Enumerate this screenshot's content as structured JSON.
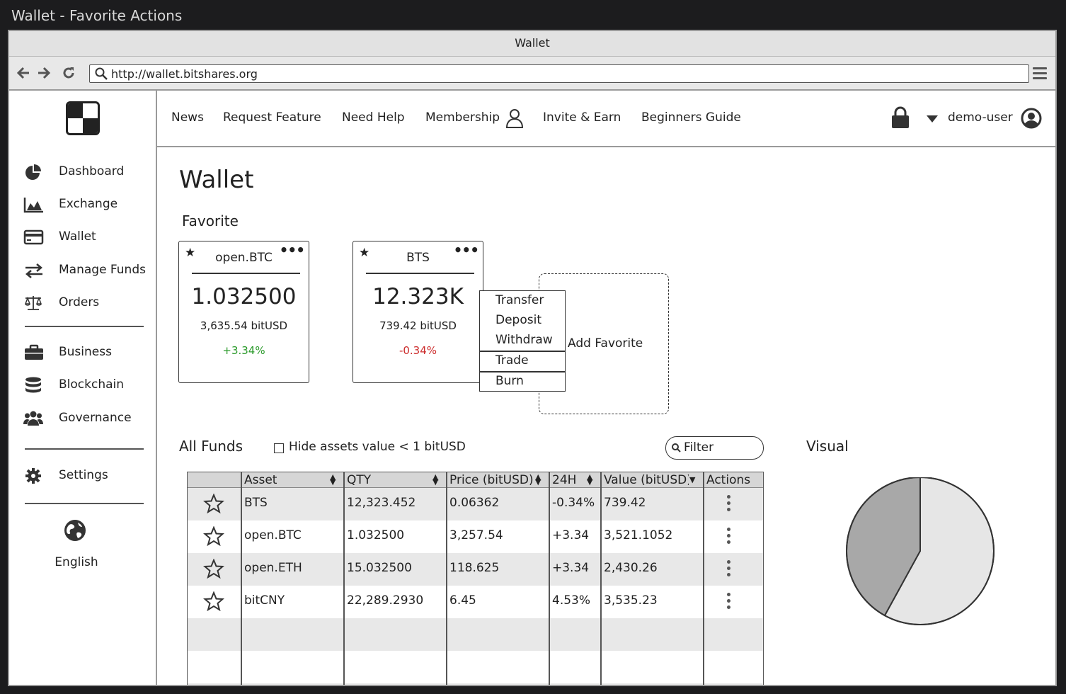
{
  "window": {
    "title": "Wallet - Favorite Actions"
  },
  "browser": {
    "tab_title": "Wallet",
    "url": "http://wallet.bitshares.org"
  },
  "sidebar": {
    "items": [
      {
        "label": "Dashboard",
        "icon": "pie-chart-icon"
      },
      {
        "label": "Exchange",
        "icon": "area-chart-icon"
      },
      {
        "label": "Wallet",
        "icon": "credit-card-icon"
      },
      {
        "label": "Manage Funds",
        "icon": "transfer-arrows-icon"
      },
      {
        "label": "Orders",
        "icon": "scales-icon"
      },
      {
        "label": "Business",
        "icon": "briefcase-icon"
      },
      {
        "label": "Blockchain",
        "icon": "database-icon"
      },
      {
        "label": "Governance",
        "icon": "users-icon"
      },
      {
        "label": "Settings",
        "icon": "gear-icon"
      }
    ],
    "language": "English"
  },
  "topnav": {
    "links": [
      "News",
      "Request Feature",
      "Need Help",
      "Membership",
      "Invite & Earn",
      "Beginners Guide"
    ],
    "user": "demo-user"
  },
  "page": {
    "title": "Wallet",
    "favorite_label": "Favorite",
    "favorites": [
      {
        "name": "open.BTC",
        "amount": "1.032500",
        "usd": "3,635.54 bitUSD",
        "change": "+3.34%"
      },
      {
        "name": "BTS",
        "amount": "12.323K",
        "usd": "739.42 bitUSD",
        "change": "-0.34%"
      }
    ],
    "add_favorite": "Add Favorite",
    "context_menu": [
      "Transfer",
      "Deposit",
      "Withdraw",
      "Trade",
      "Burn"
    ],
    "all_funds_label": "All Funds",
    "hide_assets_label": "Hide assets value < 1 bitUSD",
    "filter_placeholder": "Filter",
    "visual_label": "Visual"
  },
  "table": {
    "headers": [
      "Asset",
      "QTY",
      "Price (bitUSD)",
      "24H",
      "Value (bitUSD)",
      "Actions"
    ],
    "rows": [
      {
        "asset": "BTS",
        "qty": "12,323.452",
        "price": "0.06362",
        "change": "-0.34%",
        "value": "739.42"
      },
      {
        "asset": "open.BTC",
        "qty": "1.032500",
        "price": "3,257.54",
        "change": "+3.34",
        "value": "3,521.1052"
      },
      {
        "asset": "open.ETH",
        "qty": "15.032500",
        "price": "118.625",
        "change": "+3.34",
        "value": "2,430.26"
      },
      {
        "asset": "bitCNY",
        "qty": "22,289.2930",
        "price": "6.45",
        "change": "4.53%",
        "value": "3,535.23"
      }
    ]
  },
  "chart_data": {
    "type": "pie",
    "slices": [
      {
        "value": 58
      },
      {
        "value": 42
      }
    ],
    "colors": [
      "#e6e6e6",
      "#a8a8a8"
    ]
  }
}
